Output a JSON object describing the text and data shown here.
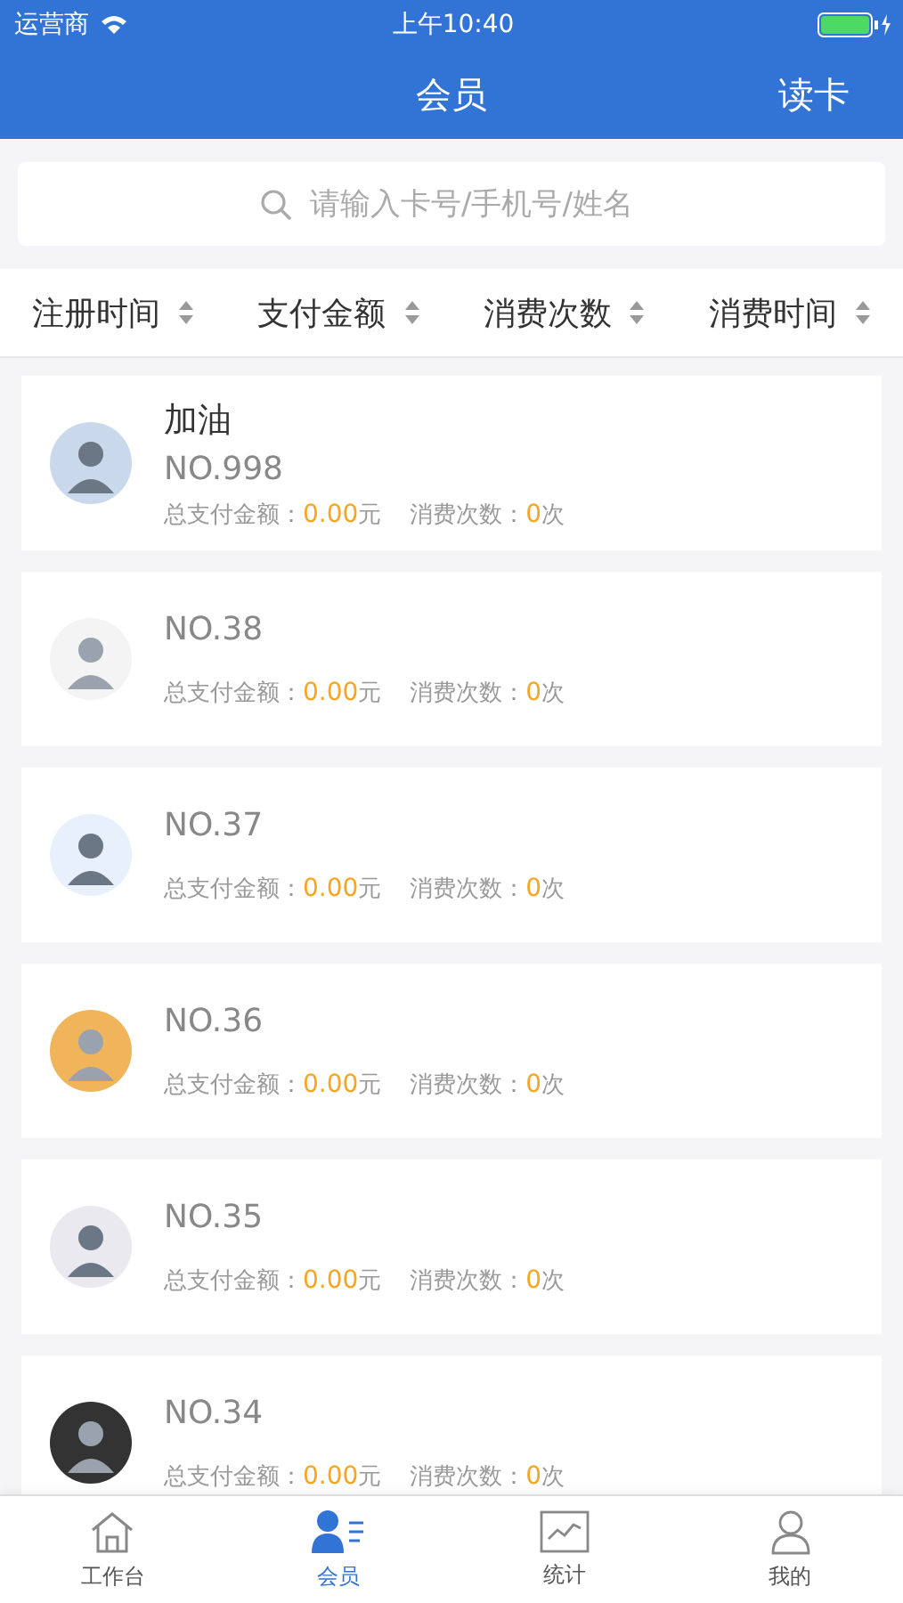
{
  "status_bar": {
    "carrier": "运营商",
    "time": "上午10:40"
  },
  "nav": {
    "title": "会员",
    "action": "读卡"
  },
  "search": {
    "placeholder": "请输入卡号/手机号/姓名"
  },
  "sort_options": [
    {
      "label": "注册时间"
    },
    {
      "label": "支付金额"
    },
    {
      "label": "消费次数"
    },
    {
      "label": "消费时间"
    }
  ],
  "members": [
    {
      "name": "加油",
      "number": "NO.998",
      "amount_label": "总支付金额：",
      "amount": "0.00",
      "amount_unit": "元",
      "count_label": "消费次数：",
      "count": "0",
      "count_unit": "次",
      "color": "#c9d8ea"
    },
    {
      "number": "NO.38",
      "amount_label": "总支付金额：",
      "amount": "0.00",
      "amount_unit": "元",
      "count_label": "消费次数：",
      "count": "0",
      "count_unit": "次",
      "color": "#f4f4f4"
    },
    {
      "number": "NO.37",
      "amount_label": "总支付金额：",
      "amount": "0.00",
      "amount_unit": "元",
      "count_label": "消费次数：",
      "count": "0",
      "count_unit": "次",
      "color": "#e8f1fb"
    },
    {
      "number": "NO.36",
      "amount_label": "总支付金额：",
      "amount": "0.00",
      "amount_unit": "元",
      "count_label": "消费次数：",
      "count": "0",
      "count_unit": "次",
      "color": "#f0b45a"
    },
    {
      "number": "NO.35",
      "amount_label": "总支付金额：",
      "amount": "0.00",
      "amount_unit": "元",
      "count_label": "消费次数：",
      "count": "0",
      "count_unit": "次",
      "color": "#e9e9ef"
    },
    {
      "number": "NO.34",
      "amount_label": "总支付金额：",
      "amount": "0.00",
      "amount_unit": "元",
      "count_label": "消费次数：",
      "count": "0",
      "count_unit": "次",
      "color": "#333333"
    }
  ],
  "tabs": [
    {
      "label": "工作台",
      "kind": "home",
      "selected": false
    },
    {
      "label": "会员",
      "kind": "members",
      "selected": true
    },
    {
      "label": "统计",
      "kind": "stats",
      "selected": false
    },
    {
      "label": "我的",
      "kind": "profile",
      "selected": false
    }
  ]
}
